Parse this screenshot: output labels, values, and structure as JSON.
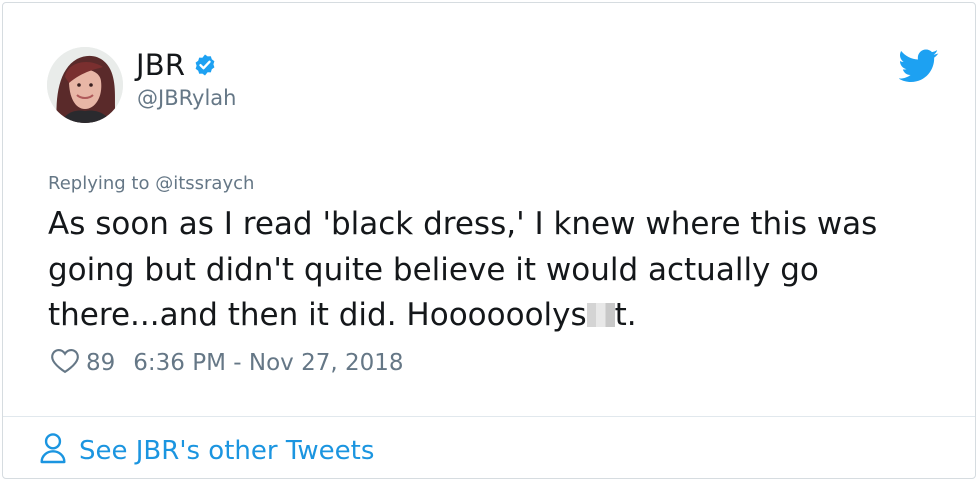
{
  "tweet": {
    "author": {
      "name": "JBR",
      "handle": "@JBRylah",
      "verified": true,
      "avatar": "avatar-photo"
    },
    "reply_to_label": "Replying to @itssraych",
    "text_main": "As soon as I read 'black dress,' I knew where this was going but didn't quite believe it would actually go there...and then it did. Hoooooolys",
    "text_tail": "t.",
    "likes": "89",
    "timestamp": "6:36 PM - Nov 27, 2018",
    "icons": {
      "brand": "twitter-bird-icon",
      "verified": "verified-badge-icon",
      "like": "heart-icon",
      "profile": "person-icon"
    }
  },
  "footer": {
    "link_label": "See JBR's other Tweets"
  },
  "colors": {
    "brand": "#1da1f2",
    "link": "#1b95e0",
    "secondary_text": "#657786",
    "primary_text": "#14171a"
  }
}
